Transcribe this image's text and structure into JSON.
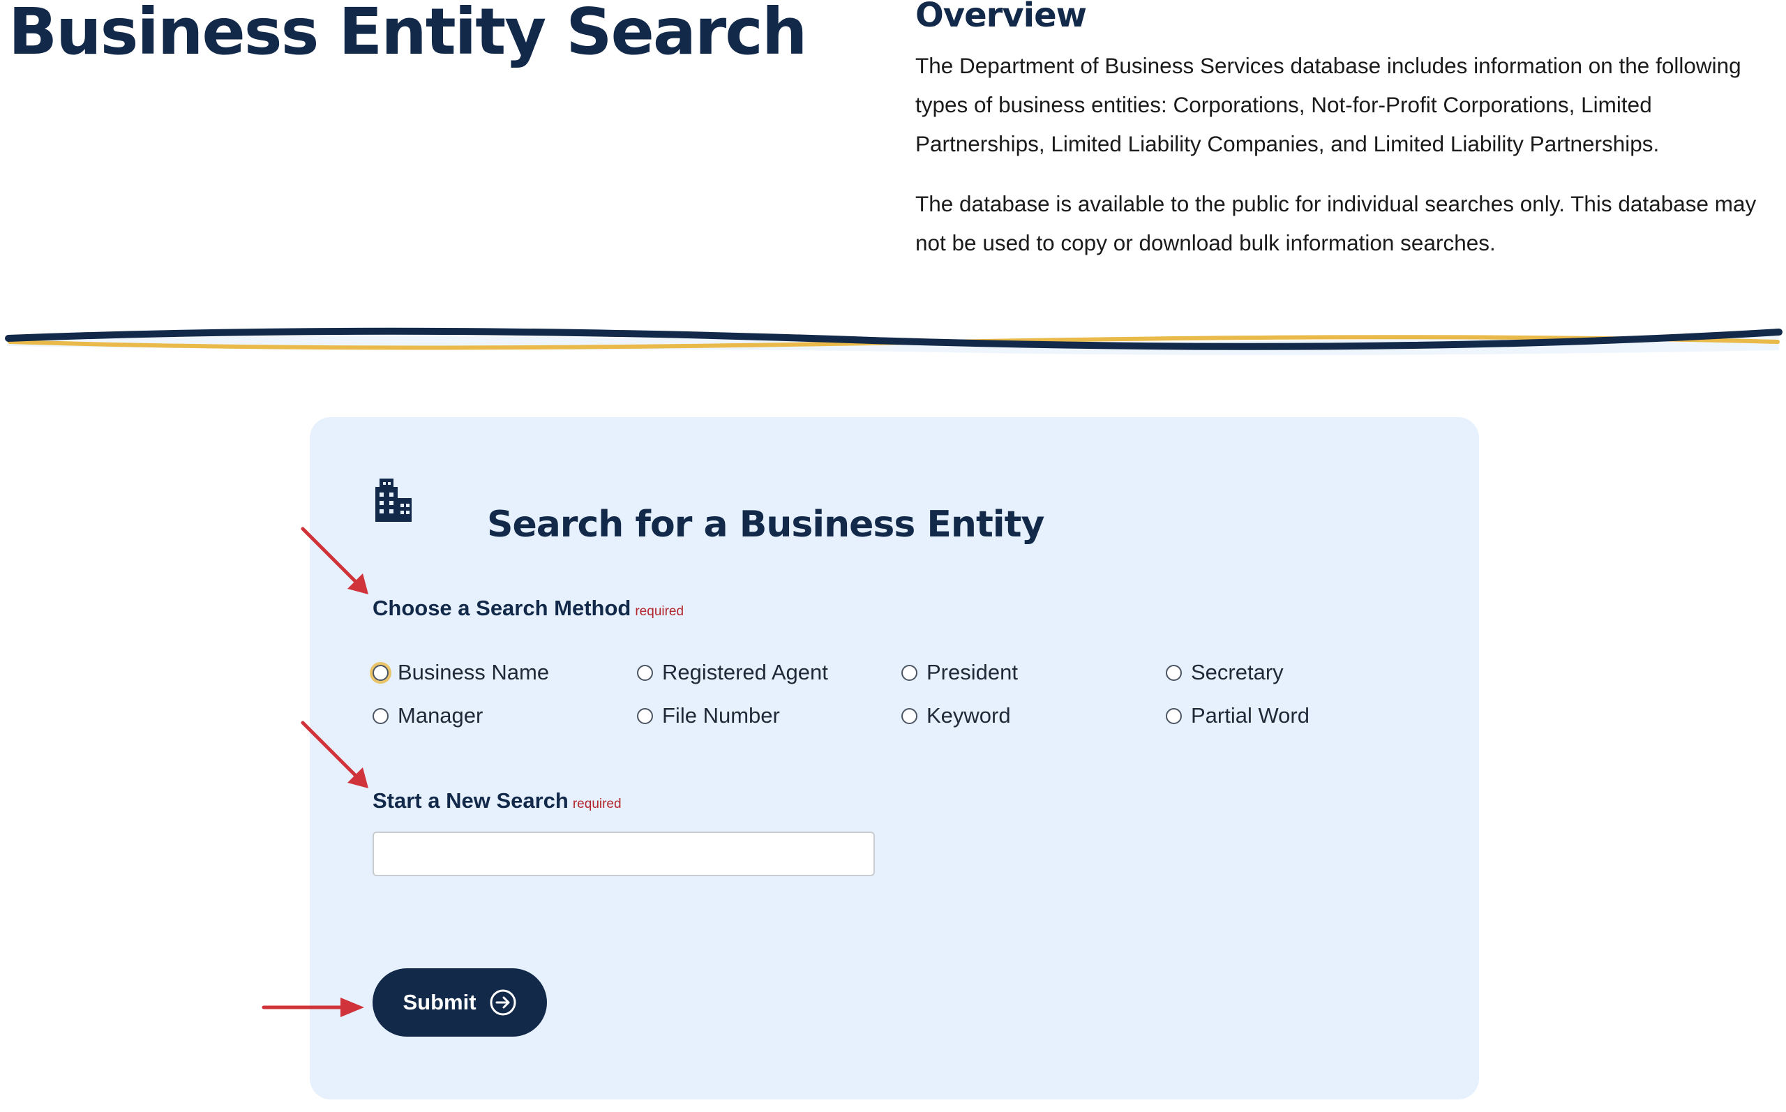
{
  "page": {
    "title": "Business Entity Search"
  },
  "overview": {
    "heading": "Overview",
    "paragraphs": [
      "The Department of Business Services database includes information on the following types of business entities: Corporations, Not-for-Profit Corporations, Limited Partnerships, Limited Liability Companies, and Limited Liability Partnerships.",
      "The database is available to the public for individual searches only. This database may not be used to copy or download bulk information searches."
    ]
  },
  "search_card": {
    "icon": "building-icon",
    "title": "Search for a Business Entity",
    "method_label": "Choose a Search Method",
    "method_required": "required",
    "methods": [
      {
        "label": "Business Name",
        "focused": true
      },
      {
        "label": "Registered Agent",
        "focused": false
      },
      {
        "label": "President",
        "focused": false
      },
      {
        "label": "Secretary",
        "focused": false
      },
      {
        "label": "Manager",
        "focused": false
      },
      {
        "label": "File Number",
        "focused": false
      },
      {
        "label": "Keyword",
        "focused": false
      },
      {
        "label": "Partial Word",
        "focused": false
      }
    ],
    "search_label": "Start a New Search",
    "search_required": "required",
    "search_value": "",
    "submit_label": "Submit",
    "submit_icon": "arrow-circle-right-icon"
  },
  "annotations": {
    "arrow_color": "#d0343a",
    "arrows": [
      "method-label-arrow",
      "search-label-arrow",
      "submit-arrow"
    ]
  },
  "colors": {
    "navy": "#12294a",
    "gold": "#e9b949",
    "card_background": "#e6f1fd",
    "required": "#b3242c"
  }
}
